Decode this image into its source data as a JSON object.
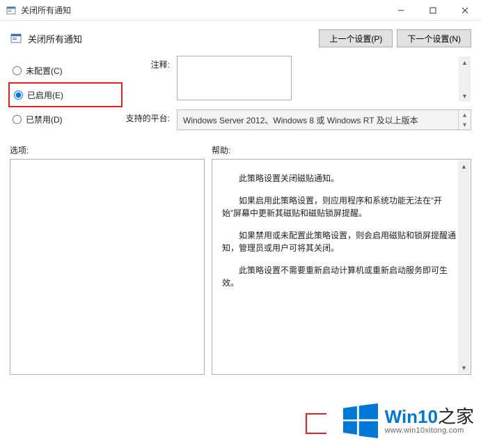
{
  "window": {
    "title": "关闭所有通知"
  },
  "header": {
    "title": "关闭所有通知",
    "prev_btn": "上一个设置(P)",
    "next_btn": "下一个设置(N)"
  },
  "radios": {
    "not_configured": "未配置(C)",
    "enabled": "已启用(E)",
    "disabled": "已禁用(D)",
    "selected": "enabled"
  },
  "comment": {
    "label": "注释:",
    "value": ""
  },
  "platform": {
    "label": "支持的平台:",
    "value": "Windows Server 2012、Windows 8 或 Windows RT 及以上版本"
  },
  "lower": {
    "options_label": "选项:",
    "help_label": "帮助:"
  },
  "help_text": {
    "p1": "此策略设置关闭磁贴通知。",
    "p2": "如果启用此策略设置，则应用程序和系统功能无法在“开始”屏幕中更新其磁贴和磁贴锁屏提醒。",
    "p3": "如果禁用或未配置此策略设置，则会启用磁贴和锁屏提醒通知，管理员或用户可将其关闭。",
    "p4": "此策略设置不需要重新启动计算机或重新启动服务即可生效。"
  },
  "watermark": {
    "brand_main": "Win10",
    "brand_suffix": "之家",
    "url": "www.win10xitong.com"
  }
}
